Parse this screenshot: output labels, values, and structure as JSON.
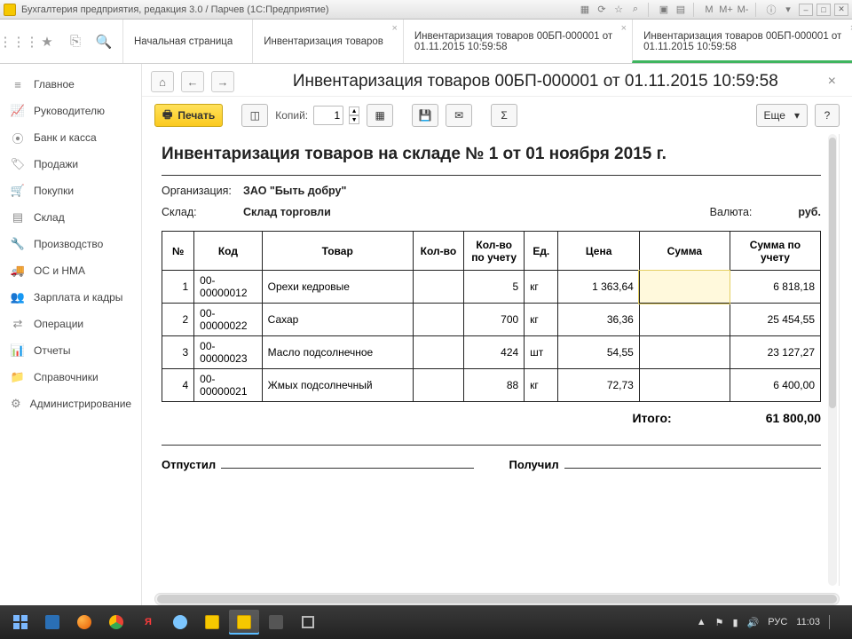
{
  "window": {
    "title": "Бухгалтерия предприятия, редакция 3.0 / Парчев  (1С:Предприятие)"
  },
  "chrome_icons": [
    "M",
    "M+",
    "M-"
  ],
  "window_controls": [
    "–",
    "□",
    "✕"
  ],
  "tabs": {
    "start": "Начальная страница",
    "t1": {
      "line1": "Инвентаризация товаров"
    },
    "t2": {
      "line1": "Инвентаризация товаров 00БП-000001 от",
      "line2": "01.11.2015 10:59:58"
    },
    "t3": {
      "line1": "Инвентаризация товаров 00БП-000001 от",
      "line2": "01.11.2015 10:59:58"
    }
  },
  "sidebar": {
    "items": [
      {
        "icon": "≡",
        "label": "Главное"
      },
      {
        "icon": "📈",
        "label": "Руководителю"
      },
      {
        "icon": "⦿",
        "label": "Банк и касса"
      },
      {
        "icon": "🏷",
        "label": "Продажи"
      },
      {
        "icon": "🛒",
        "label": "Покупки"
      },
      {
        "icon": "▤",
        "label": "Склад"
      },
      {
        "icon": "🔧",
        "label": "Производство"
      },
      {
        "icon": "🚚",
        "label": "ОС и НМА"
      },
      {
        "icon": "👥",
        "label": "Зарплата и кадры"
      },
      {
        "icon": "⇄",
        "label": "Операции"
      },
      {
        "icon": "📊",
        "label": "Отчеты"
      },
      {
        "icon": "📁",
        "label": "Справочники"
      },
      {
        "icon": "⚙",
        "label": "Администрирование"
      }
    ]
  },
  "page": {
    "title": "Инвентаризация товаров 00БП-000001 от 01.11.2015 10:59:58",
    "toolbar": {
      "print": "Печать",
      "copies_label": "Копий:",
      "copies_value": "1",
      "more": "Еще",
      "help": "?"
    }
  },
  "report": {
    "heading": "Инвентаризация товаров на складе № 1 от 01 ноября 2015 г.",
    "org_label": "Организация:",
    "org_value": "ЗАО \"Быть добру\"",
    "wh_label": "Склад:",
    "wh_value": "Склад торговли",
    "curr_label": "Валюта:",
    "curr_value": "руб.",
    "columns": {
      "no": "№",
      "code": "Код",
      "item": "Товар",
      "q": "Кол-во",
      "qacc": "Кол-во по учету",
      "unit": "Ед.",
      "price": "Цена",
      "sum": "Сумма",
      "sumacc": "Сумма по учету"
    },
    "rows": [
      {
        "no": "1",
        "code": "00-00000012",
        "item": "Орехи кедровые",
        "q": "",
        "qacc": "5",
        "unit": "кг",
        "price": "1 363,64",
        "sum": "",
        "sumacc": "6 818,18"
      },
      {
        "no": "2",
        "code": "00-00000022",
        "item": "Сахар",
        "q": "",
        "qacc": "700",
        "unit": "кг",
        "price": "36,36",
        "sum": "",
        "sumacc": "25 454,55"
      },
      {
        "no": "3",
        "code": "00-00000023",
        "item": "Масло подсолнечное",
        "q": "",
        "qacc": "424",
        "unit": "шт",
        "price": "54,55",
        "sum": "",
        "sumacc": "23 127,27"
      },
      {
        "no": "4",
        "code": "00-00000021",
        "item": "Жмых подсолнечный",
        "q": "",
        "qacc": "88",
        "unit": "кг",
        "price": "72,73",
        "sum": "",
        "sumacc": "6 400,00"
      }
    ],
    "total_label": "Итого:",
    "total_value": "61 800,00",
    "sign_left": "Отпустил",
    "sign_right": "Получил"
  },
  "taskbar": {
    "lang": "РУС",
    "clock": "11:03"
  }
}
